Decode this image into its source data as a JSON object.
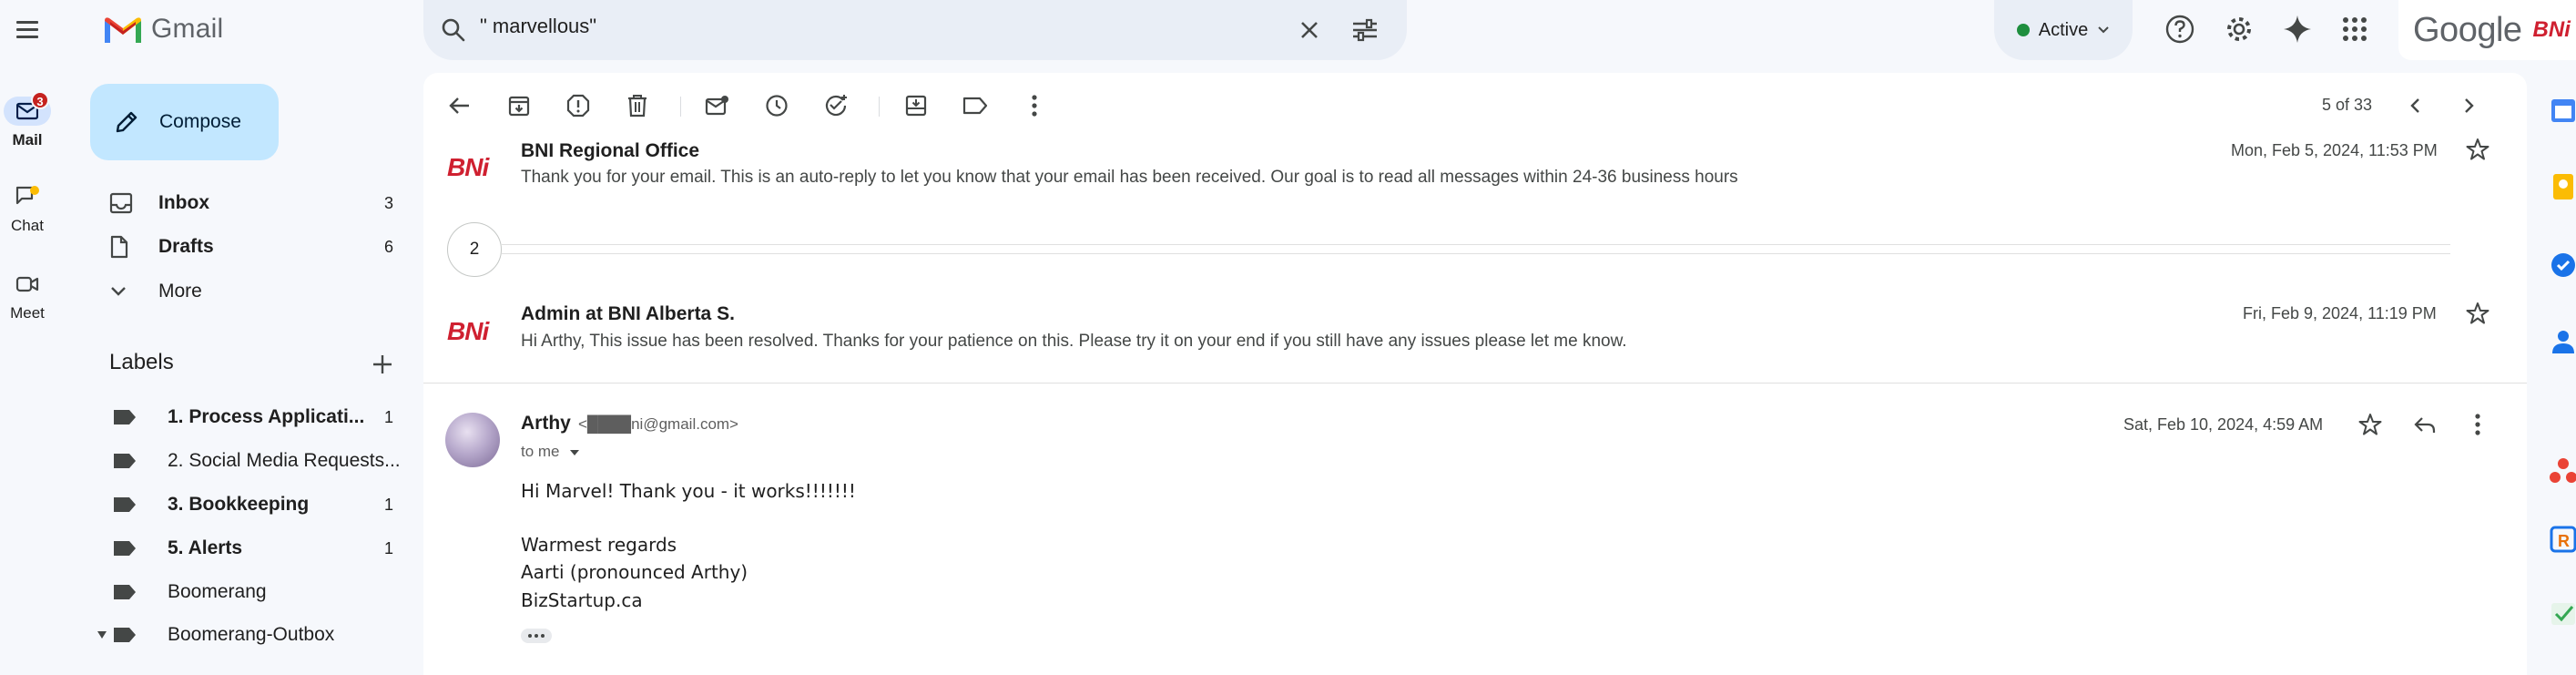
{
  "app": {
    "name": "Gmail"
  },
  "rail": {
    "items": [
      {
        "label": "Mail",
        "badge": "3",
        "icon": "mail-icon"
      },
      {
        "label": "Chat",
        "icon": "chat-icon"
      },
      {
        "label": "Meet",
        "icon": "meet-icon"
      }
    ]
  },
  "search": {
    "query": "\" marvellous\""
  },
  "header": {
    "status": "Active",
    "google": "Google",
    "account_brand": "BNi"
  },
  "compose": {
    "label": "Compose"
  },
  "nav": [
    {
      "label": "Inbox",
      "count": "3",
      "bold": true
    },
    {
      "label": "Drafts",
      "count": "6",
      "bold": true
    },
    {
      "label": "More",
      "count": ""
    }
  ],
  "labels": {
    "heading": "Labels",
    "items": [
      {
        "label": "1. Process Applicati...",
        "count": "1",
        "bold": true
      },
      {
        "label": "2. Social Media Requests...",
        "count": "",
        "bold": false
      },
      {
        "label": "3. Bookkeeping",
        "count": "1",
        "bold": true
      },
      {
        "label": "5. Alerts",
        "count": "1",
        "bold": true
      },
      {
        "label": "Boomerang",
        "count": "",
        "bold": false
      },
      {
        "label": "Boomerang-Outbox",
        "count": "",
        "bold": false
      }
    ]
  },
  "toolbar": {
    "pager": "5 of 33"
  },
  "thread": {
    "messages": [
      {
        "sender": "BNI Regional Office",
        "snippet": "Thank you for your email. This is an auto-reply to let you know that your email has been received. Our goal is to read all messages within 24-36 business hours",
        "date": "Mon, Feb 5, 2024, 11:53 PM"
      },
      {
        "collapsed_count": "2"
      },
      {
        "sender": "Admin at BNI Alberta S.",
        "snippet": "Hi Arthy, This issue has been resolved. Thanks for your patience on this. Please try it on your end if you still have any issues please let me know.",
        "date": "Fri, Feb 9, 2024, 11:19 PM"
      }
    ],
    "open_message": {
      "sender": "Arthy",
      "email": "<████ni@gmail.com>",
      "to": "to me",
      "date": "Sat, Feb 10, 2024, 4:59 AM",
      "body": [
        "Hi Marvel! Thank you - it works!!!!!!!",
        "Warmest regards",
        "Aarti (pronounced Arthy)",
        "BizStartup.ca"
      ]
    }
  },
  "colors": {
    "accent": "#0b57d0",
    "compose_bg": "#c2e7ff",
    "bni_red": "#cf2030",
    "active_green": "#1e8e3e"
  }
}
